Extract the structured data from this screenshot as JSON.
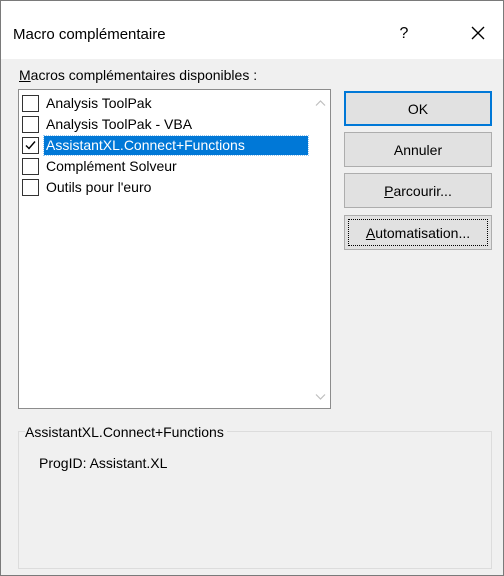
{
  "window": {
    "title": "Macro complémentaire",
    "help_label": "?",
    "close_icon": "close-icon"
  },
  "list": {
    "label_prefix": "",
    "label_access": "M",
    "label_rest": "acros complémentaires disponibles :",
    "items": [
      {
        "label": "Analysis ToolPak",
        "checked": false,
        "selected": false
      },
      {
        "label": "Analysis ToolPak - VBA",
        "checked": false,
        "selected": false
      },
      {
        "label": "AssistantXL.Connect+Functions",
        "checked": true,
        "selected": true
      },
      {
        "label": "Complément Solveur",
        "checked": false,
        "selected": false
      },
      {
        "label": "Outils pour l'euro",
        "checked": false,
        "selected": false
      }
    ]
  },
  "buttons": {
    "ok": "OK",
    "annuler": "Annuler",
    "parcourir_access": "P",
    "parcourir_rest": "arcourir...",
    "auto_access": "A",
    "auto_rest": "utomatisation..."
  },
  "details": {
    "legend": "AssistantXL.Connect+Functions",
    "progid": "ProgID: Assistant.XL"
  },
  "colors": {
    "selection": "#0078d7",
    "default_button_border": "#0078d7"
  }
}
